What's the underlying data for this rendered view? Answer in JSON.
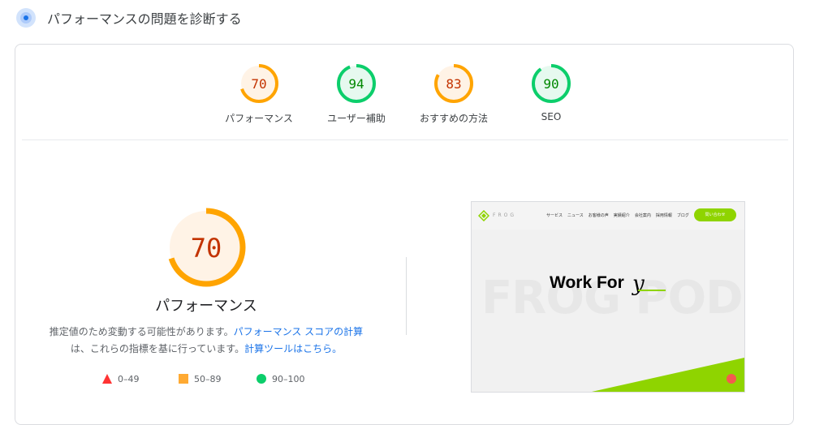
{
  "header": {
    "title": "パフォーマンスの問題を診断する",
    "icon": "diagnostic-gauge-icon"
  },
  "gauges": [
    {
      "label": "パフォーマンス",
      "score": "70",
      "value": 70,
      "status": "average"
    },
    {
      "label": "ユーザー補助",
      "score": "94",
      "value": 94,
      "status": "pass"
    },
    {
      "label": "おすすめの方法",
      "score": "83",
      "value": 83,
      "status": "average"
    },
    {
      "label": "SEO",
      "score": "90",
      "value": 90,
      "status": "pass"
    }
  ],
  "performance": {
    "score": "70",
    "value": 70,
    "title": "パフォーマンス",
    "desc_part1": "推定値のため変動する可能性があります。",
    "link1": "パフォーマンス スコアの計算",
    "desc_part2": "は、これらの指標を基に行っています。",
    "link2": "計算ツールはこちら。"
  },
  "legend": [
    {
      "range": "0–49",
      "shape": "triangle",
      "color": "#ff3333"
    },
    {
      "range": "50–89",
      "shape": "square",
      "color": "#ffaa33"
    },
    {
      "range": "90–100",
      "shape": "circle",
      "color": "#0cce6b"
    }
  ],
  "screenshot": {
    "brand": "FROG",
    "menu": [
      "サービス",
      "ニュース",
      "お客様の声",
      "実績紹介",
      "会社案内",
      "採用情報",
      "ブログ"
    ],
    "contact": "問い合わせ",
    "hero_text": "Work For",
    "hero_script": "y",
    "background_text": "FROG POD"
  },
  "colors": {
    "average_arc": "#ffa400",
    "average_fill": "#fff3e6",
    "average_text": "#c33300",
    "pass_arc": "#0cce6b",
    "pass_fill": "#e6f9ef",
    "pass_text": "#008800",
    "link": "#1a73e8",
    "accent_green": "#8fd400"
  }
}
